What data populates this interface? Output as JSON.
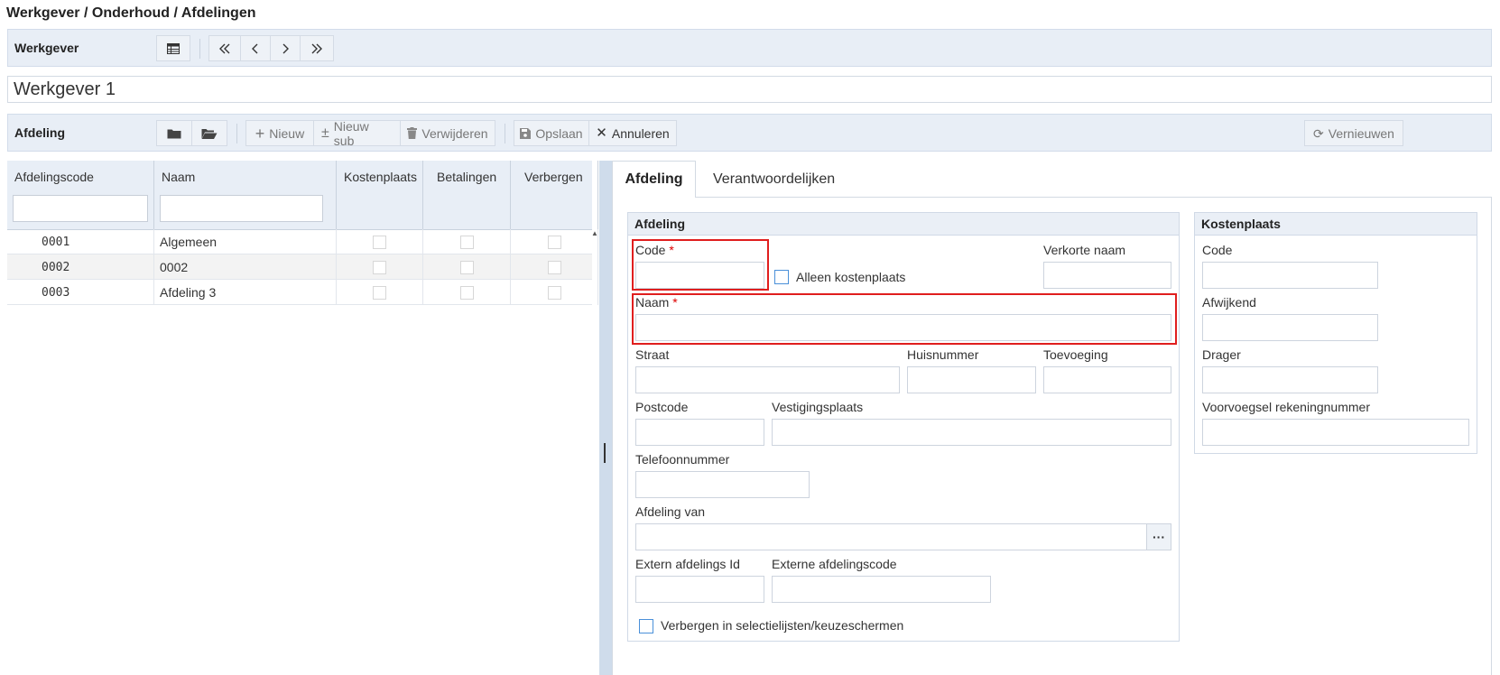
{
  "breadcrumb": "Werkgever / Onderhoud / Afdelingen",
  "werkgever_bar": {
    "title": "Werkgever"
  },
  "werkgever_name": "Werkgever 1",
  "afdeling_bar": {
    "title": "Afdeling",
    "nieuw": "Nieuw",
    "nieuw_sub": "Nieuw sub",
    "verwijderen": "Verwijderen",
    "opslaan": "Opslaan",
    "annuleren": "Annuleren",
    "vernieuwen": "Vernieuwen"
  },
  "grid": {
    "columns": [
      "Afdelingscode",
      "Naam",
      "Kostenplaats",
      "Betalingen",
      "Verbergen"
    ],
    "rows": [
      {
        "code": "0001",
        "naam": "Algemeen",
        "kostenplaats": false,
        "betalingen": false,
        "verbergen": false
      },
      {
        "code": "0002",
        "naam": "0002",
        "kostenplaats": false,
        "betalingen": false,
        "verbergen": false
      },
      {
        "code": "0003",
        "naam": "Afdeling 3",
        "kostenplaats": false,
        "betalingen": false,
        "verbergen": false
      }
    ]
  },
  "tabs": [
    {
      "label": "Afdeling",
      "active": true
    },
    {
      "label": "Verantwoordelijken",
      "active": false
    }
  ],
  "afdeling_form": {
    "title": "Afdeling",
    "code_label": "Code",
    "required_mark": "*",
    "alleen_kostenplaats": "Alleen kostenplaats",
    "verkorte_naam": "Verkorte naam",
    "naam_label": "Naam",
    "straat": "Straat",
    "huisnummer": "Huisnummer",
    "toevoeging": "Toevoeging",
    "postcode": "Postcode",
    "vestigingsplaats": "Vestigingsplaats",
    "telefoonnummer": "Telefoonnummer",
    "afdeling_van": "Afdeling van",
    "lookup_button": "···",
    "extern_id": "Extern afdelings Id",
    "externe_code": "Externe afdelingscode",
    "verbergen": "Verbergen in selectielijsten/keuzeschermen"
  },
  "kostenplaats_form": {
    "title": "Kostenplaats",
    "code": "Code",
    "afwijkend": "Afwijkend",
    "drager": "Drager",
    "voorvoegsel": "Voorvoegsel rekeningnummer"
  },
  "colors": {
    "toolbar_bg": "#e8eef6",
    "required": "#dd0000",
    "highlight": "#e01e1e",
    "checkbox": "#4a90d9"
  }
}
